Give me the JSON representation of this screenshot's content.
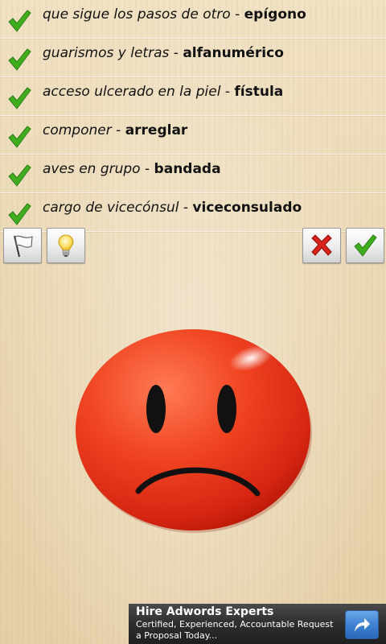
{
  "items": [
    {
      "definition": "que sigue los pasos de otro",
      "separator": " - ",
      "word": "epígono"
    },
    {
      "definition": "guarismos y letras",
      "separator": " - ",
      "word": "alfanumérico"
    },
    {
      "definition": "acceso ulcerado en la piel",
      "separator": " - ",
      "word": "fístula"
    },
    {
      "definition": "componer",
      "separator": " - ",
      "word": "arreglar"
    },
    {
      "definition": "aves en grupo",
      "separator": " - ",
      "word": "bandada"
    },
    {
      "definition": "cargo de vicecónsul",
      "separator": " - ",
      "word": "viceconsulado"
    }
  ],
  "toolbar": {
    "flag_icon": "flag-icon",
    "hint_icon": "lightbulb-icon",
    "wrong_icon": "red-x-icon",
    "right_icon": "green-check-icon"
  },
  "result": {
    "state": "incorrect",
    "face_icon": "sad-face-icon",
    "face_color": "#e8321c"
  },
  "ad": {
    "title": "Hire Adwords Experts",
    "body": "Certified, Experienced, Accountable Request a Proposal Today...",
    "button_icon": "share-arrow-icon"
  },
  "colors": {
    "check": "#3fae1e",
    "wrong": "#d8231b"
  }
}
